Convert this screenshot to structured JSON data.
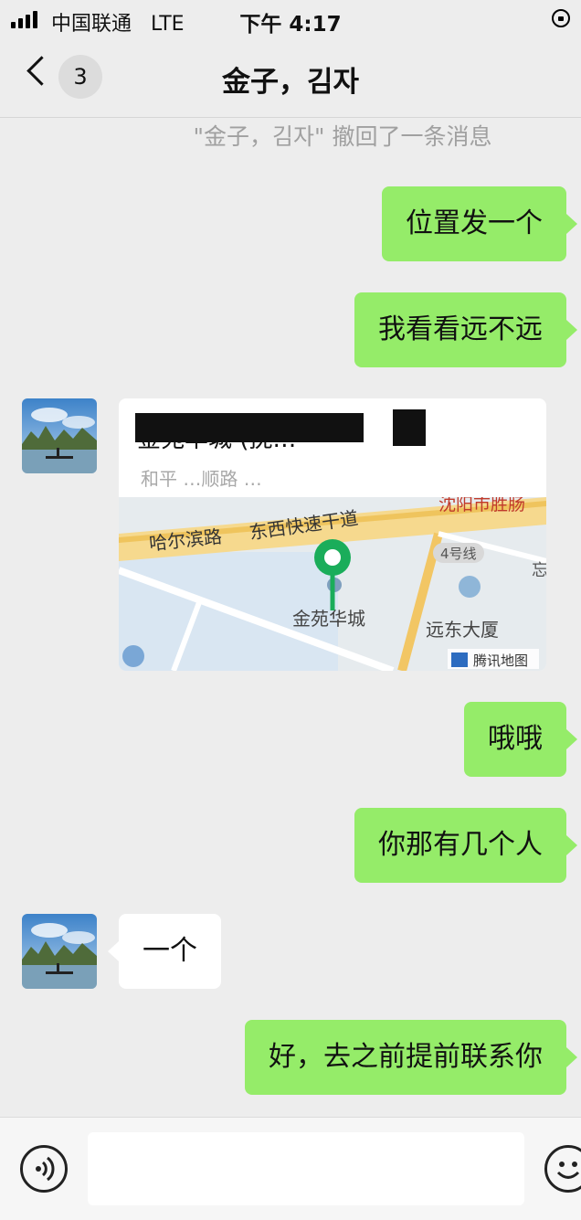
{
  "status_bar": {
    "carrier": "中国联通",
    "network": "LTE",
    "time": "下午 4:17"
  },
  "nav": {
    "title": "金子，김자",
    "unread_count": "3"
  },
  "recall_notice": "\"金子，김자\" 撤回了一条消息",
  "messages": {
    "m1": "位置发一个",
    "m2": "我看看远不远",
    "m3": "哦哦",
    "m4": "你那有几个人",
    "m5": "一个",
    "m6": "好，去之前提前联系你"
  },
  "location_card": {
    "title": "金苑华城 (抚…",
    "subtitle": "和平 …顺路 …",
    "map_labels": {
      "road1": "哈尔滨路",
      "road2": "东西快速干道",
      "place": "金苑华城",
      "building": "远东大厦",
      "metro": "4号线",
      "district": "沈阳市胜肠",
      "edge": "忘",
      "brand": "腾讯地图"
    }
  },
  "input": {
    "value": "",
    "placeholder": ""
  },
  "colors": {
    "my_bubble": "#95ec69",
    "their_bubble": "#ffffff",
    "background": "#ededed",
    "pin": "#1aad5a"
  }
}
